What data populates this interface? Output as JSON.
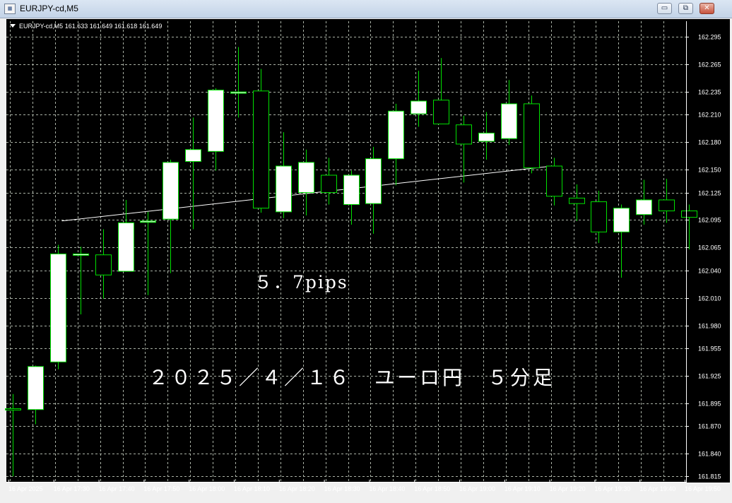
{
  "window": {
    "title": "EURJPY-cd,M5",
    "buttons": {
      "minimize": "▭",
      "restore": "⧉",
      "close": "✕"
    }
  },
  "chart_header": "EURJPY-cd,M5  161.633 161.649 161.618 161.649",
  "annotations": {
    "pips": "５．7pips",
    "caption": "２０２５／４／１６　ユーロ円　５分足"
  },
  "colors": {
    "background": "#000000",
    "grid": "#aab2a6",
    "bull_outline": "#00e000",
    "bull_fill": "#ffffff",
    "bear_fill": "#000000",
    "axis_text": "#ffffff",
    "trendline": "#ffffff"
  },
  "chart_data": {
    "type": "candlestick",
    "symbol": "EURJPY-cd",
    "timeframe": "M5",
    "y_ticks": [
      "162.295",
      "162.265",
      "162.235",
      "162.210",
      "162.180",
      "162.150",
      "162.125",
      "162.095",
      "162.065",
      "162.040",
      "162.010",
      "161.980",
      "161.955",
      "161.925",
      "161.895",
      "161.870",
      "161.840",
      "161.815"
    ],
    "x_ticks": [
      "16 Apr 2025",
      "16 Apr 17:30",
      "16 Apr 17:40",
      "16 Apr 17:50",
      "16 Apr 18:00",
      "16 Apr 18:10",
      "16 Apr 18:20",
      "16 Apr 18:30",
      "16 Apr 18:40",
      "16 Apr 18:50",
      "16 Apr 19:00",
      "16 Apr 19:10",
      "16 Apr 19:20",
      "16 Apr 19:30",
      "16 Apr 19:40",
      "16 Apr 19:50"
    ],
    "ylim": [
      161.81,
      162.305
    ],
    "grid": true,
    "candles": [
      {
        "o": 161.889,
        "h": 161.905,
        "l": 161.815,
        "c": 161.888
      },
      {
        "o": 161.888,
        "h": 161.936,
        "l": 161.872,
        "c": 161.935
      },
      {
        "o": 161.94,
        "h": 162.068,
        "l": 161.932,
        "c": 162.058
      },
      {
        "o": 162.058,
        "h": 162.066,
        "l": 161.992,
        "c": 162.058
      },
      {
        "o": 162.057,
        "h": 162.085,
        "l": 162.009,
        "c": 162.035
      },
      {
        "o": 162.039,
        "h": 162.117,
        "l": 162.039,
        "c": 162.092
      },
      {
        "o": 162.093,
        "h": 162.104,
        "l": 162.013,
        "c": 162.094
      },
      {
        "o": 162.096,
        "h": 162.161,
        "l": 162.037,
        "c": 162.158
      },
      {
        "o": 162.159,
        "h": 162.207,
        "l": 162.085,
        "c": 162.172
      },
      {
        "o": 162.17,
        "h": 162.239,
        "l": 162.149,
        "c": 162.237
      },
      {
        "o": 162.235,
        "h": 162.284,
        "l": 162.207,
        "c": 162.235
      },
      {
        "o": 162.236,
        "h": 162.26,
        "l": 162.103,
        "c": 162.108
      },
      {
        "o": 162.104,
        "h": 162.191,
        "l": 162.097,
        "c": 162.154
      },
      {
        "o": 162.125,
        "h": 162.172,
        "l": 162.1,
        "c": 162.158
      },
      {
        "o": 162.144,
        "h": 162.163,
        "l": 162.112,
        "c": 162.125
      },
      {
        "o": 162.112,
        "h": 162.149,
        "l": 162.09,
        "c": 162.144
      },
      {
        "o": 162.113,
        "h": 162.175,
        "l": 162.08,
        "c": 162.162
      },
      {
        "o": 162.162,
        "h": 162.222,
        "l": 162.133,
        "c": 162.214
      },
      {
        "o": 162.211,
        "h": 162.258,
        "l": 162.197,
        "c": 162.225
      },
      {
        "o": 162.226,
        "h": 162.272,
        "l": 162.203,
        "c": 162.2
      },
      {
        "o": 162.199,
        "h": 162.209,
        "l": 162.136,
        "c": 162.178
      },
      {
        "o": 162.181,
        "h": 162.213,
        "l": 162.161,
        "c": 162.19
      },
      {
        "o": 162.184,
        "h": 162.248,
        "l": 162.177,
        "c": 162.222
      },
      {
        "o": 162.222,
        "h": 162.231,
        "l": 162.146,
        "c": 162.152
      },
      {
        "o": 162.154,
        "h": 162.163,
        "l": 162.111,
        "c": 162.121
      },
      {
        "o": 162.119,
        "h": 162.134,
        "l": 162.094,
        "c": 162.113
      },
      {
        "o": 162.115,
        "h": 162.127,
        "l": 162.07,
        "c": 162.082
      },
      {
        "o": 162.082,
        "h": 162.112,
        "l": 162.032,
        "c": 162.108
      },
      {
        "o": 162.101,
        "h": 162.139,
        "l": 162.09,
        "c": 162.117
      },
      {
        "o": 162.117,
        "h": 162.14,
        "l": 162.092,
        "c": 162.105
      },
      {
        "o": 162.105,
        "h": 162.112,
        "l": 162.063,
        "c": 162.098
      }
    ],
    "trendline": {
      "from": [
        5,
        162.097
      ],
      "to": [
        23,
        162.153
      ]
    }
  }
}
